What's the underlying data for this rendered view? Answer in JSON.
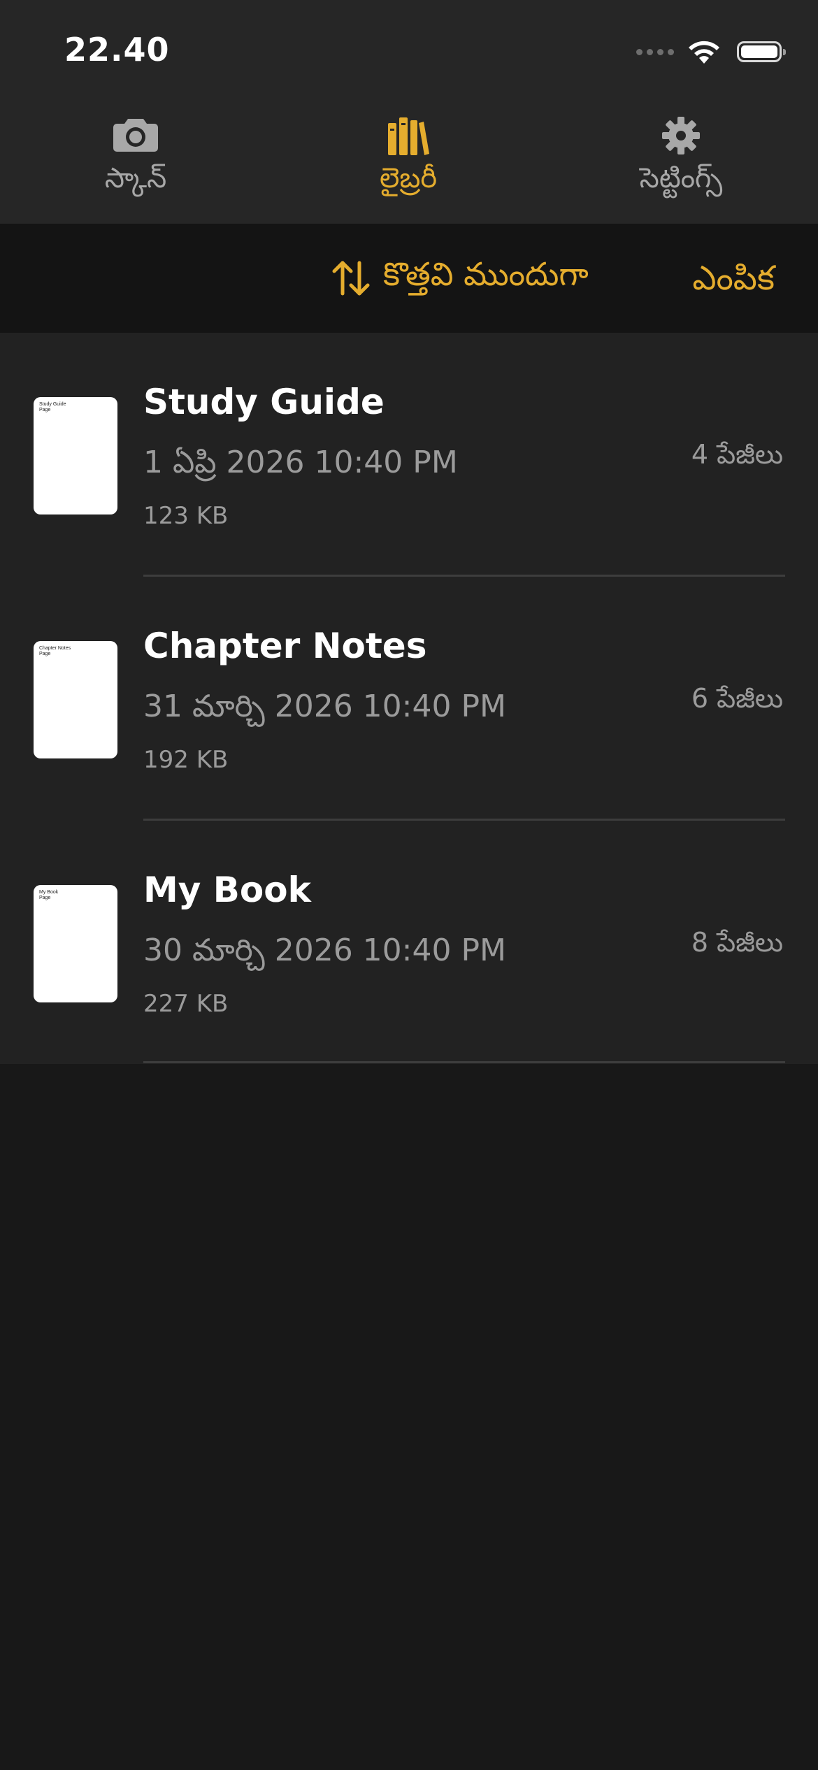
{
  "status_bar": {
    "time": "22.40"
  },
  "tabs": [
    {
      "label": "స్కాన్",
      "icon": "camera-icon",
      "active": false
    },
    {
      "label": "లైబ్రరీ",
      "icon": "library-books-icon",
      "active": true
    },
    {
      "label": "సెట్టింగ్స్",
      "icon": "gear-icon",
      "active": false
    }
  ],
  "toolbar": {
    "sort_label": "కొత్తవి ముందుగా",
    "sort_icon": "sort-arrows-icon",
    "select_label": "ఎంపిక"
  },
  "documents": [
    {
      "title": "Study Guide",
      "date": "1 ఏప్రి 2026 10:40 PM",
      "size": "123 KB",
      "pages": "4 పేజీలు",
      "thumb_title": "Study Guide",
      "thumb_sub": "Page"
    },
    {
      "title": "Chapter Notes",
      "date": "31 మార్చి 2026 10:40 PM",
      "size": "192 KB",
      "pages": "6 పేజీలు",
      "thumb_title": "Chapter Notes",
      "thumb_sub": "Page"
    },
    {
      "title": "My Book",
      "date": "30 మార్చి 2026 10:40 PM",
      "size": "227 KB",
      "pages": "8 పేజీలు",
      "thumb_title": "My Book",
      "thumb_sub": "Page"
    }
  ],
  "colors": {
    "accent": "#e5ad2e",
    "background": "#181818",
    "header": "#262626",
    "list": "#222222",
    "secondary_text": "#9b9b9b"
  }
}
